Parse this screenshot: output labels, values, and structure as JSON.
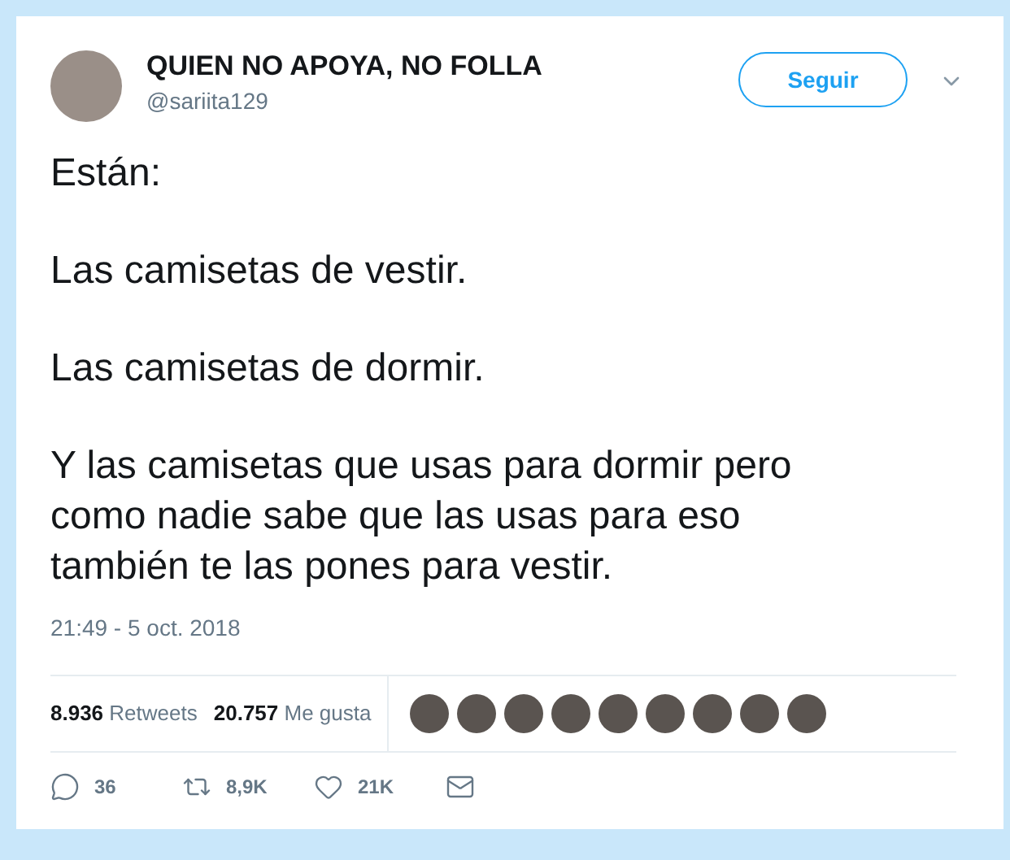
{
  "author": {
    "name": "QUIEN NO APOYA, NO FOLLA",
    "handle": "@sariita129"
  },
  "follow_button": "Seguir",
  "tweet_paragraphs": [
    "Están:",
    "Las camisetas de vestir.",
    "Las camisetas de dormir.",
    "Y las camisetas que usas para dormir pero como nadie sabe que las usas para eso también te las pones para vestir."
  ],
  "timestamp": "21:49 - 5 oct. 2018",
  "stats": [
    {
      "count": "8.936",
      "label": "Retweets"
    },
    {
      "count": "20.757",
      "label": "Me gusta"
    }
  ],
  "liker_avatars": [
    {
      "kind": "photo"
    },
    {
      "kind": "photo"
    },
    {
      "kind": "photo"
    },
    {
      "kind": "photo"
    },
    {
      "kind": "photo"
    },
    {
      "kind": "photo"
    },
    {
      "kind": "photo"
    },
    {
      "kind": "photo"
    },
    {
      "kind": "photo"
    }
  ],
  "actions": [
    {
      "kind": "reply",
      "count": "36"
    },
    {
      "kind": "retweet",
      "count": "8,9K"
    },
    {
      "kind": "like",
      "count": "21K"
    },
    {
      "kind": "message"
    }
  ]
}
